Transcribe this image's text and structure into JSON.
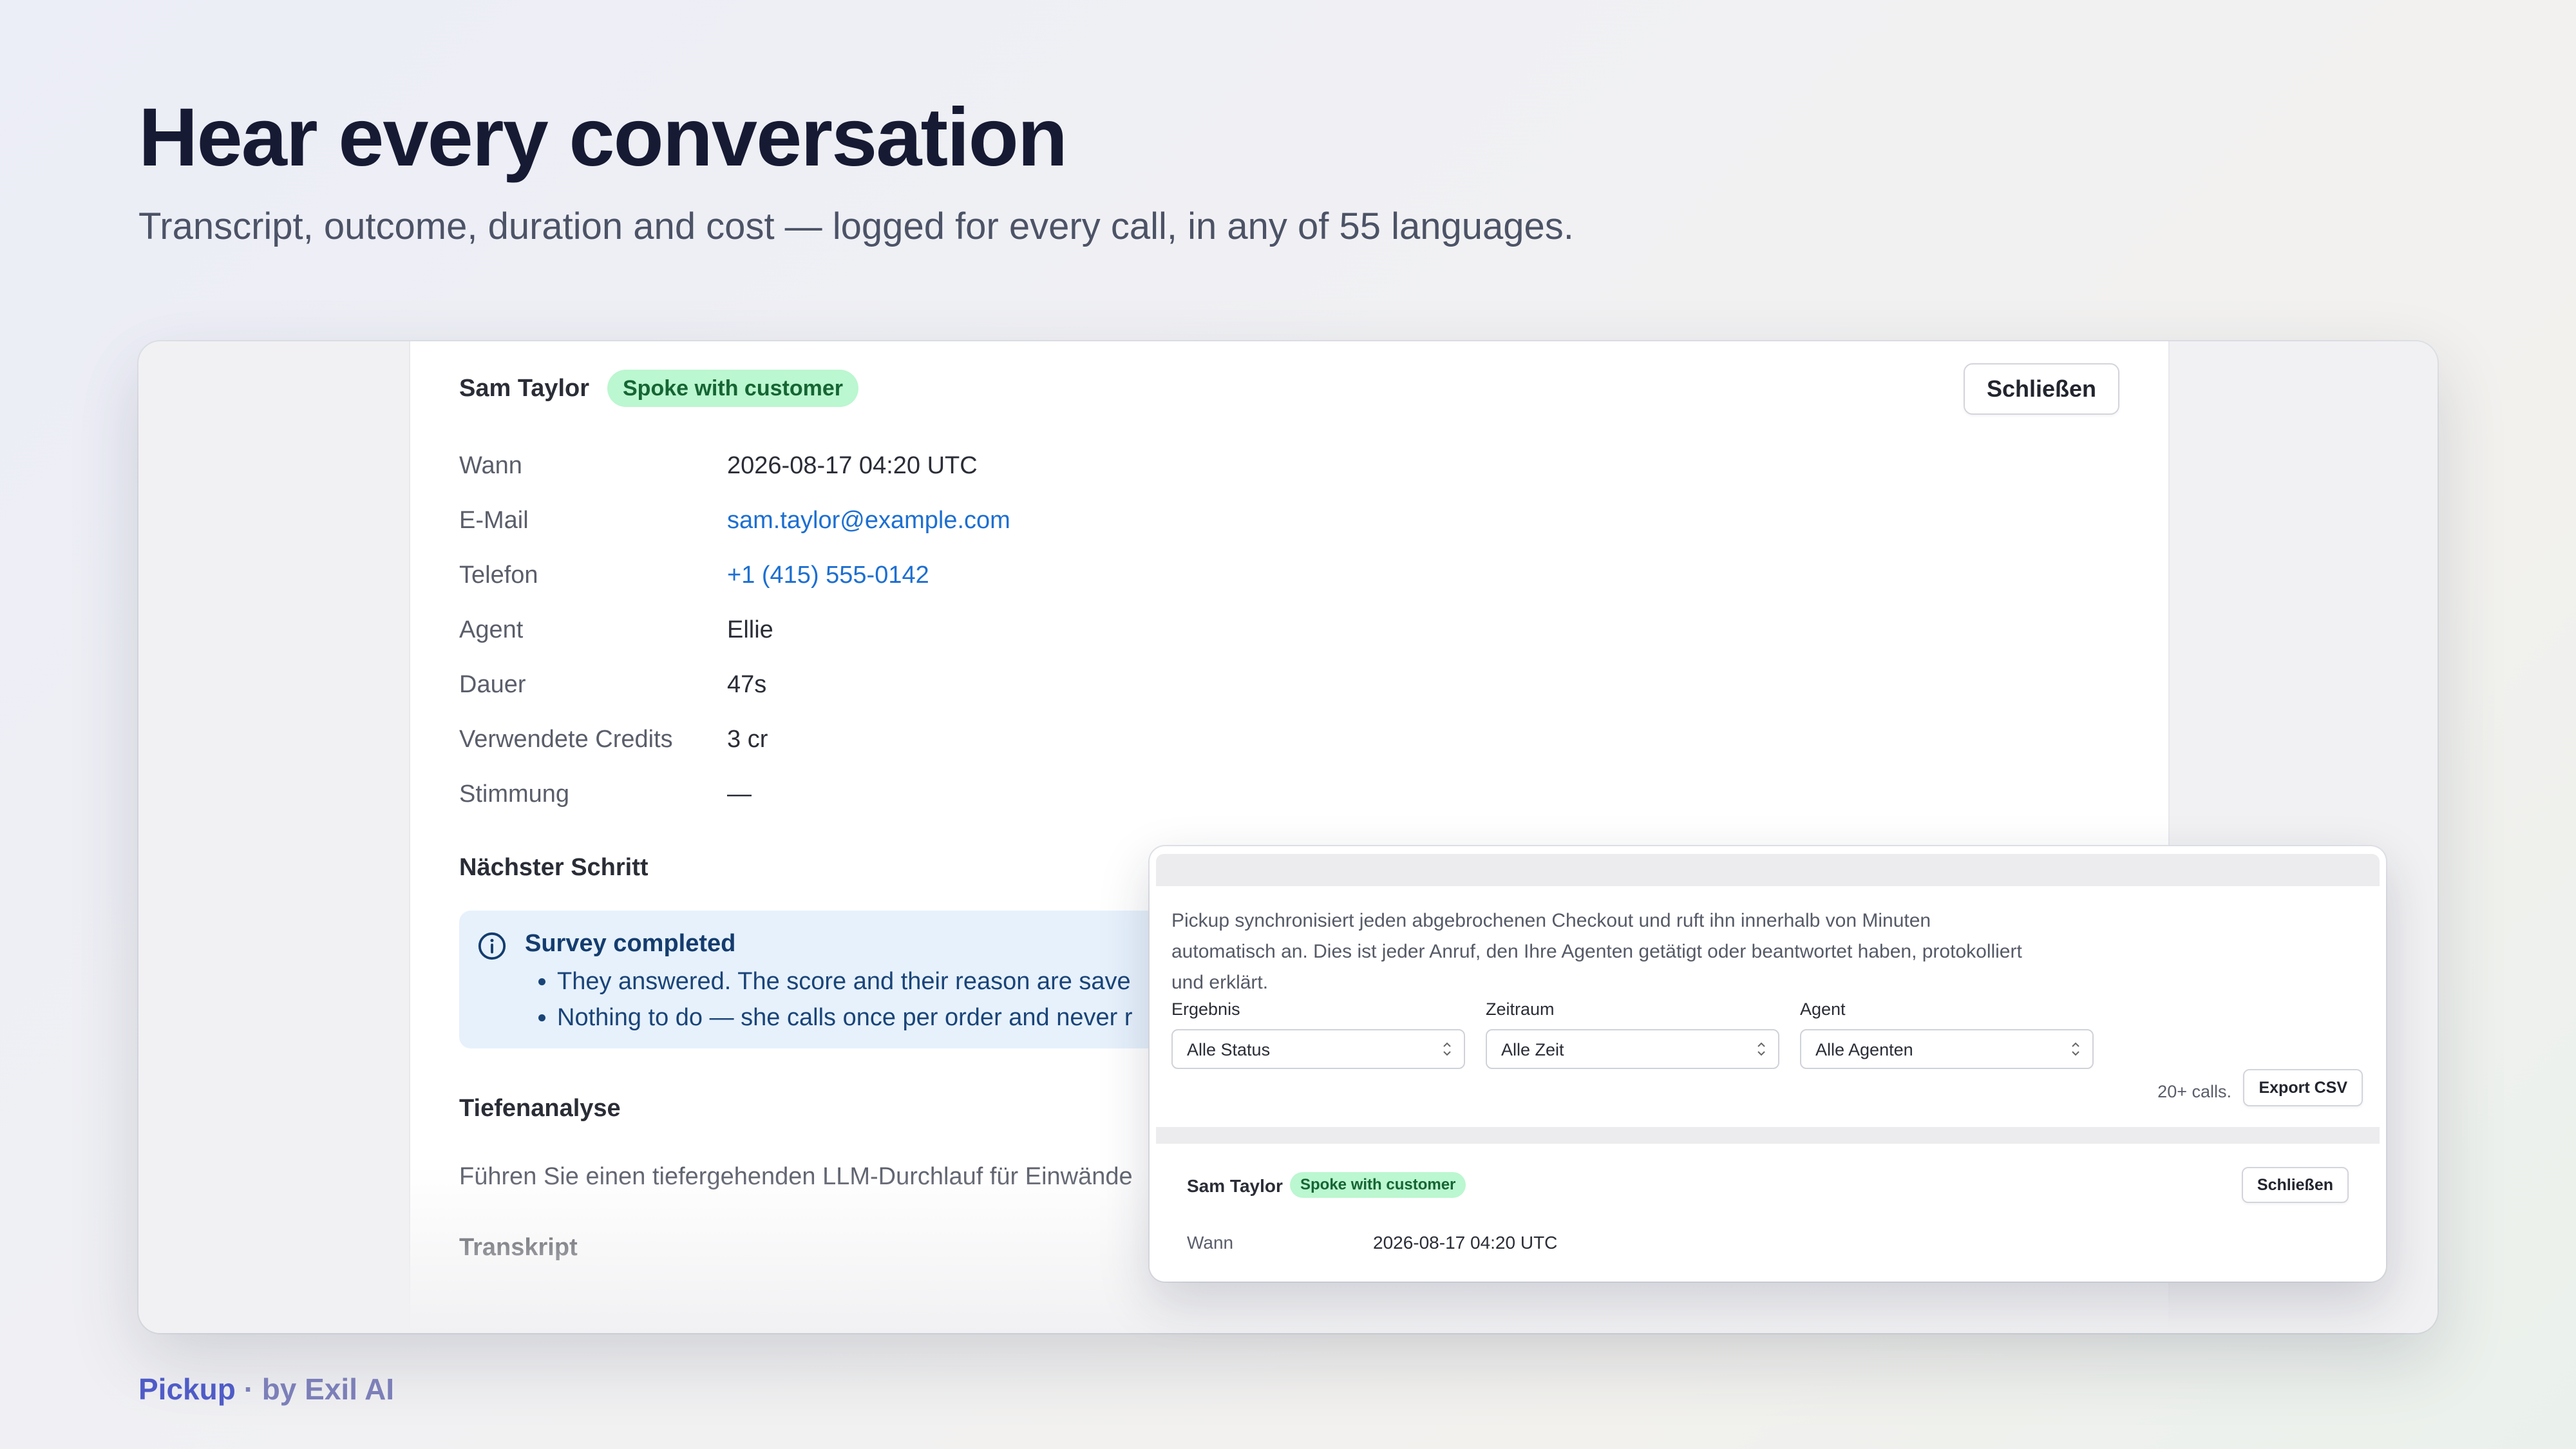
{
  "hero": {
    "title": "Hear every conversation",
    "subtitle": "Transcript, outcome, duration and cost — logged for every call, in any of 55 languages."
  },
  "detail": {
    "name": "Sam Taylor",
    "badge": "Spoke with customer",
    "close_label": "Schließen",
    "fields": [
      {
        "label": "Wann",
        "value": "2026-08-17 04:20 UTC"
      },
      {
        "label": "E-Mail",
        "value": "sam.taylor@example.com"
      },
      {
        "label": "Telefon",
        "value": "+1 (415) 555-0142"
      },
      {
        "label": "Agent",
        "value": "Ellie"
      },
      {
        "label": "Dauer",
        "value": "47s"
      },
      {
        "label": "Verwendete Credits",
        "value": "3 cr"
      },
      {
        "label": "Stimmung",
        "value": "—"
      }
    ],
    "next_step": {
      "heading": "Nächster Schritt",
      "title": "Survey completed",
      "bullets": [
        "They answered. The score and their reason are save",
        "Nothing to do — she calls once per order and never r"
      ]
    },
    "deep_analysis": {
      "heading": "Tiefenanalyse",
      "text": "Führen Sie einen tiefergehenden LLM-Durchlauf für Einwände"
    },
    "transcript_heading": "Transkript"
  },
  "popup": {
    "description": "Pickup synchronisiert jeden abgebrochenen Checkout und ruft ihn innerhalb von Minuten automatisch an. Dies ist jeder Anruf, den Ihre Agenten getätigt oder beantwortet haben, protokolliert und erklärt.",
    "filters": [
      {
        "label": "Ergebnis",
        "value": "Alle Status"
      },
      {
        "label": "Zeitraum",
        "value": "Alle Zeit"
      },
      {
        "label": "Agent",
        "value": "Alle Agenten"
      }
    ],
    "count": "20+ calls.",
    "export_label": "Export CSV",
    "row": {
      "name": "Sam Taylor",
      "badge": "Spoke with customer",
      "close_label": "Schließen",
      "field_label": "Wann",
      "field_value": "2026-08-17 04:20 UTC"
    }
  },
  "footer": {
    "brand": "Pickup",
    "by": " · by Exil AI"
  },
  "colors": {
    "accent": "#4f5cc7",
    "link": "#1d6fd1",
    "badge_bg": "#bbf7d0",
    "badge_text": "#166534",
    "info_bg": "#e6f1fc"
  }
}
